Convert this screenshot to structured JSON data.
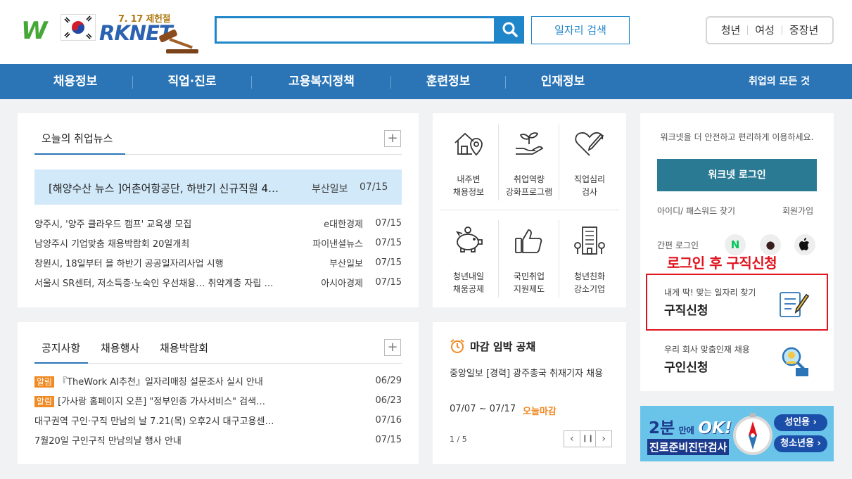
{
  "header": {
    "logo_anniversary": "7. 17 제헌절",
    "logo_w": "W",
    "logo_text": "RKNET",
    "search_placeholder": "",
    "job_search_label": "일자리 검색",
    "quick_links": [
      "청년",
      "여성",
      "중장년"
    ]
  },
  "nav": {
    "items": [
      "채용정보",
      "직업·진로",
      "고용복지정책",
      "훈련정보",
      "인재정보"
    ],
    "all_label": "취업의 모든 것"
  },
  "news": {
    "tab": "오늘의 취업뉴스",
    "plus": "+",
    "highlight": {
      "title": "[해양수산 뉴스 ]어촌어항공단, 하반기 신규직원 4…",
      "source": "부산일보",
      "date": "07/15"
    },
    "items": [
      {
        "title": "양주시, '양주 클라우드 캠프' 교육생 모집",
        "source": "e대한경제",
        "date": "07/15"
      },
      {
        "title": "남양주시 기업맞춤 채용박람회 20일개최",
        "source": "파이낸셜뉴스",
        "date": "07/15"
      },
      {
        "title": "창원시, 18일부터 을 하반기 공공일자리사업 시행",
        "source": "부산일보",
        "date": "07/15"
      },
      {
        "title": "서울시 SR센터, 저소득층·노숙인 우선채용… 취약계층 자립 …",
        "source": "아시아경제",
        "date": "07/15"
      }
    ]
  },
  "notice": {
    "tabs": [
      "공지사항",
      "채용행사",
      "채용박람회"
    ],
    "plus": "+",
    "items": [
      {
        "badge": "알림",
        "title": "『TheWork AI추천』일자리매칭 설문조사 실시 안내",
        "date": "06/29"
      },
      {
        "badge": "알림",
        "title": "[가사랑 홈페이지 오픈] \"정부인증 가사서비스\" 검색…",
        "date": "06/23"
      },
      {
        "badge": "",
        "title": "대구권역 구인·구직 만남의 날 7.21(목) 오후2시 대구고용센…",
        "date": "07/16"
      },
      {
        "badge": "",
        "title": "7월20일 구인구직 만남의날 행사 안내",
        "date": "07/15"
      }
    ]
  },
  "services": [
    {
      "line1": "내주변",
      "line2": "채용정보",
      "icon": "house-location-icon"
    },
    {
      "line1": "취업역량",
      "line2": "강화프로그램",
      "icon": "hand-sprout-icon"
    },
    {
      "line1": "직업심리",
      "line2": "검사",
      "icon": "heart-pen-icon"
    },
    {
      "line1": "청년내일",
      "line2": "채움공제",
      "icon": "piggy-bank-icon"
    },
    {
      "line1": "국민취업",
      "line2": "지원제도",
      "icon": "thumbs-up-icon"
    },
    {
      "line1": "청년친화",
      "line2": "강소기업",
      "icon": "building-icon"
    }
  ],
  "deadline": {
    "title": "마감 임박 공채",
    "company": "중앙일보",
    "job": "[경력] 광주총국 취재기자 채용",
    "period": "07/07 ~ 07/17",
    "status": "오늘마감",
    "pager": "1 / 5"
  },
  "login": {
    "intro": "워크넷을 더 안전하고 편리하게 이용하세요.",
    "button": "워크넷 로그인",
    "find": "아이디/ 패스워드 찾기",
    "join": "회원가입",
    "easy": "간편 로그인",
    "sns": [
      "N",
      "●",
      ""
    ],
    "seek_sub": "내게 딱! 맞는 일자리 찾기",
    "seek_main": "구직신청",
    "hire_sub": "우리 회사 맞춤인재 채용",
    "hire_main": "구인신청"
  },
  "annotation": "로그인 후 구직신청",
  "banner": {
    "big1": "2분",
    "small": "만에",
    "big2": "OK!",
    "sub": "진로준비진단검사",
    "btn1": "성인용 ›",
    "btn2": "청소년용 ›"
  },
  "colors": {
    "primary": "#2b75b6",
    "accent": "#1f86c9",
    "orange": "#f08a24",
    "red": "#e0141e"
  }
}
